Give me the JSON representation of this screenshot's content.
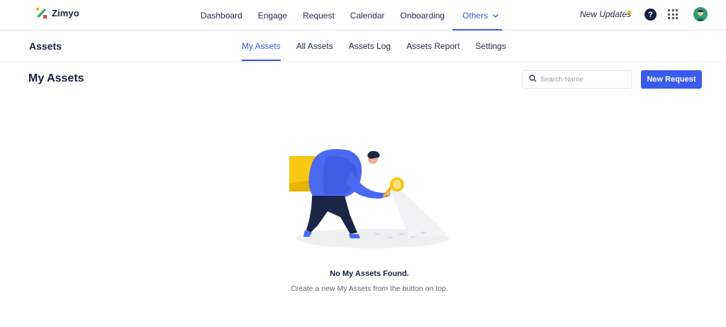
{
  "app": {
    "name": "Zimyo"
  },
  "nav": {
    "items": [
      {
        "label": "Dashboard"
      },
      {
        "label": "Engage"
      },
      {
        "label": "Request"
      },
      {
        "label": "Calendar"
      },
      {
        "label": "Onboarding"
      },
      {
        "label": "Others",
        "active": true
      }
    ],
    "updates_label": "New Updates",
    "help_label": "?"
  },
  "module": {
    "title": "Assets",
    "tabs": [
      {
        "label": "My Assets",
        "active": true
      },
      {
        "label": "All Assets"
      },
      {
        "label": "Assets Log"
      },
      {
        "label": "Assets Report"
      },
      {
        "label": "Settings"
      }
    ]
  },
  "page": {
    "title": "My Assets",
    "search": {
      "placeholder": "Search Name",
      "value": ""
    },
    "new_button_label": "New Request"
  },
  "empty_state": {
    "title": "No My Assets Found.",
    "subtitle": "Create a new My Assets from the button on top."
  },
  "colors": {
    "accent": "#3a5bd9",
    "button": "#3a5bec",
    "text": "#1f2a44",
    "updates_dot": "#f5b400"
  },
  "icons": [
    "zimyo-logo",
    "chevron-down-icon",
    "help-icon",
    "apps-grid-icon",
    "avatar",
    "search-icon",
    "empty-search-illustration"
  ]
}
